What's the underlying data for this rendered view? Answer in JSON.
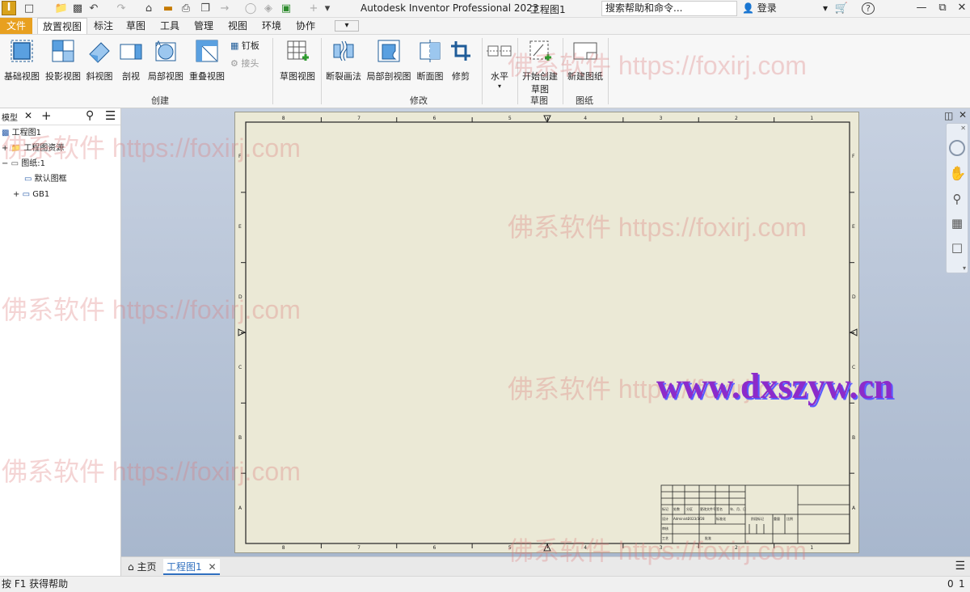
{
  "titlebar": {
    "logo": "I",
    "app_title": "Autodesk Inventor Professional 2023",
    "doc_title": "工程图1",
    "search_placeholder": "搜索帮助和命令...",
    "login_label": "登录",
    "help_label": "?"
  },
  "ribbon_tabs": [
    "文件",
    "放置视图",
    "标注",
    "草图",
    "工具",
    "管理",
    "视图",
    "环境",
    "协作"
  ],
  "ribbon": {
    "create_buttons": [
      "基础视图",
      "投影视图",
      "斜视图",
      "剖视",
      "局部视图",
      "重叠视图"
    ],
    "small_buttons": [
      "钉板",
      "接头"
    ],
    "sketch_view": "草图视图",
    "modify_buttons": [
      "断裂画法",
      "局部剖视图",
      "断面图",
      "修剪"
    ],
    "horizontal": "水平",
    "start_sketch": [
      "开始创建",
      "草图"
    ],
    "new_sheet": "新建图纸",
    "groups": {
      "create": "创建",
      "modify": "修改",
      "sketch": "草图",
      "sheet": "图纸"
    }
  },
  "browser": {
    "tab_label": "模型",
    "tree": [
      "工程图1",
      "工程图资源",
      "图纸:1",
      "默认图框",
      "GB1"
    ]
  },
  "sheet": {
    "top_numbers": [
      "8",
      "7",
      "6",
      "5",
      "4",
      "3",
      "2",
      "1"
    ],
    "side_letters": [
      "F",
      "E",
      "D",
      "C",
      "B",
      "A"
    ],
    "title_block": {
      "row1": [
        "标记",
        "处数",
        "分区",
        "更改文件号",
        "签名",
        "年、月、日"
      ],
      "row2": [
        "设计",
        "Administr",
        "2023/3/28",
        "标准化"
      ],
      "row3": [
        "审核"
      ],
      "row4": [
        "工艺",
        "批准"
      ],
      "labels": [
        "阶段标记",
        "重量",
        "比例"
      ]
    }
  },
  "doc_tabs": {
    "home": "主页",
    "active": "工程图1"
  },
  "status": {
    "help_text": "按 F1 获得帮助",
    "counters": [
      "0",
      "1"
    ]
  },
  "watermarks": {
    "text": "佛系软件 https://foxirj.com",
    "url_banner": "www.dxszyw.cn"
  },
  "colors": {
    "accent": "#f5a623",
    "file_tab": "#e8a020",
    "sheet": "#ebe9d6",
    "canvas_top": "#c7d1e1",
    "canvas_bottom": "#a8b7cd",
    "active_doc_tab": "#2f6fbf"
  }
}
